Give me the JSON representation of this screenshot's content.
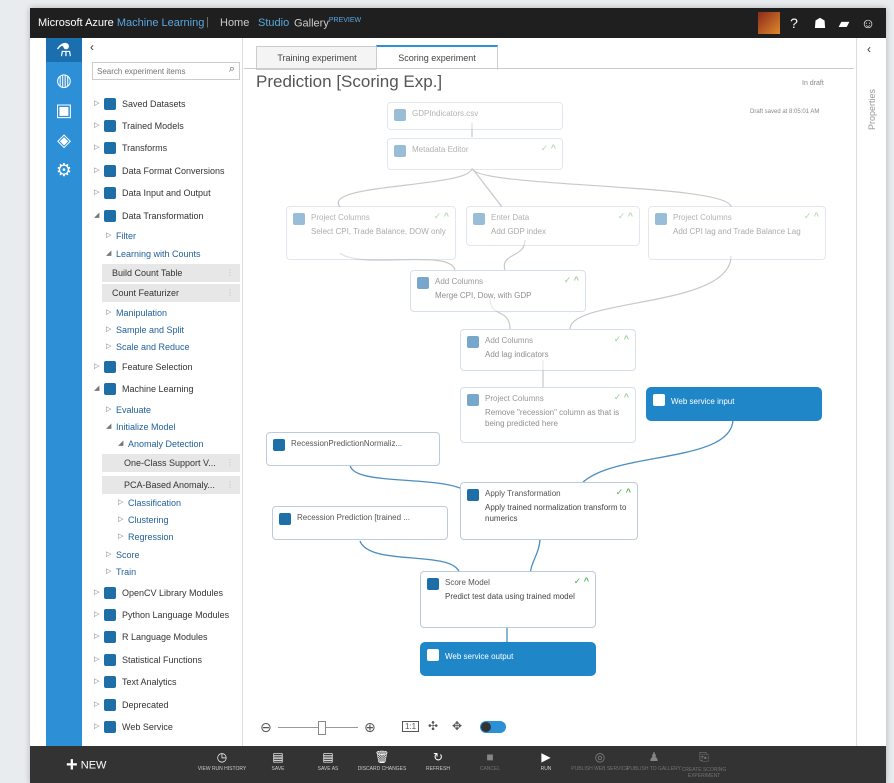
{
  "topbar": {
    "brand": "Microsoft Azure",
    "brand_ml": "Machine Learning",
    "nav": [
      "Home",
      "Studio",
      "Gallery"
    ],
    "preview": "PREVIEW"
  },
  "palette": {
    "search_placeholder": "Search experiment items",
    "items": [
      {
        "label": "Saved Datasets"
      },
      {
        "label": "Trained Models"
      },
      {
        "label": "Transforms"
      },
      {
        "label": "Data Format Conversions"
      },
      {
        "label": "Data Input and Output"
      },
      {
        "label": "Data Transformation"
      },
      {
        "label": "Filter"
      },
      {
        "label": "Learning with Counts"
      },
      {
        "label": "Build Count Table"
      },
      {
        "label": "Count Featurizer"
      },
      {
        "label": "Manipulation"
      },
      {
        "label": "Sample and Split"
      },
      {
        "label": "Scale and Reduce"
      },
      {
        "label": "Feature Selection"
      },
      {
        "label": "Machine Learning"
      },
      {
        "label": "Evaluate"
      },
      {
        "label": "Initialize Model"
      },
      {
        "label": "Anomaly Detection"
      },
      {
        "label": "One-Class Support V..."
      },
      {
        "label": "PCA-Based Anomaly..."
      },
      {
        "label": "Classification"
      },
      {
        "label": "Clustering"
      },
      {
        "label": "Regression"
      },
      {
        "label": "Score"
      },
      {
        "label": "Train"
      },
      {
        "label": "OpenCV Library Modules"
      },
      {
        "label": "Python Language Modules"
      },
      {
        "label": "R Language Modules"
      },
      {
        "label": "Statistical Functions"
      },
      {
        "label": "Text Analytics"
      },
      {
        "label": "Deprecated"
      },
      {
        "label": "Web Service"
      }
    ]
  },
  "tabs": [
    "Training experiment",
    "Scoring experiment"
  ],
  "experiment": {
    "title": "Prediction [Scoring Exp.]",
    "status": "In draft",
    "saved": "Draft saved at 8:05:01 AM"
  },
  "properties_label": "Properties",
  "nodes": [
    {
      "title": "GDPIndicators.csv",
      "desc": ""
    },
    {
      "title": "Metadata Editor",
      "desc": ""
    },
    {
      "title": "Project Columns",
      "desc": "Select CPI, Trade Balance, DOW only"
    },
    {
      "title": "Enter Data",
      "desc": "Add GDP index"
    },
    {
      "title": "Project Columns",
      "desc": "Add CPI lag and Trade Balance Lag"
    },
    {
      "title": "Add Columns",
      "desc": "Merge CPI, Dow, with GDP"
    },
    {
      "title": "Add Columns",
      "desc": "Add lag indicators"
    },
    {
      "title": "Project Columns",
      "desc": "Remove \"recession\" column as that is being predicted here"
    },
    {
      "title": "Web service input",
      "desc": ""
    },
    {
      "title": "RecessionPredictionNormaliz...",
      "desc": ""
    },
    {
      "title": "Apply Transformation",
      "desc": "Apply trained normalization transform to numerics"
    },
    {
      "title": "Recession Prediction [trained ...",
      "desc": ""
    },
    {
      "title": "Score Model",
      "desc": "Predict test data  using trained model"
    },
    {
      "title": "Web service output",
      "desc": ""
    }
  ],
  "zoom": {
    "fit_label": "1:1"
  },
  "toolbar": {
    "new_label": "NEW",
    "buttons": [
      {
        "label": "VIEW RUN HISTORY"
      },
      {
        "label": "SAVE"
      },
      {
        "label": "SAVE AS"
      },
      {
        "label": "DISCARD CHANGES"
      },
      {
        "label": "REFRESH"
      },
      {
        "label": "CANCEL"
      },
      {
        "label": "RUN"
      },
      {
        "label": "PUBLISH WEB SERVICE"
      },
      {
        "label": "PUBLISH TO GALLERY"
      },
      {
        "label": "CREATE SCORING EXPERIMENT"
      }
    ]
  }
}
